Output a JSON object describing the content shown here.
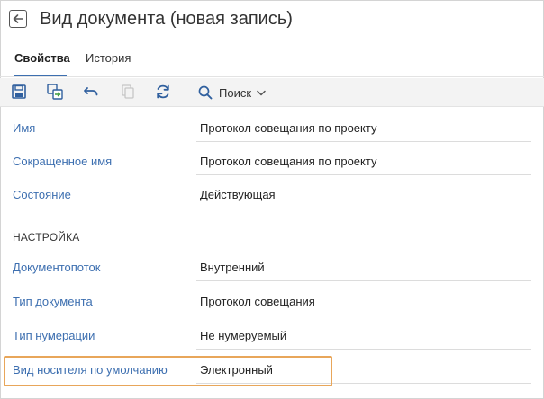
{
  "window": {
    "title": "Вид документа (новая запись)"
  },
  "tabs": [
    {
      "label": "Свойства",
      "active": true
    },
    {
      "label": "История",
      "active": false
    }
  ],
  "toolbar": {
    "icons": [
      "save-icon",
      "save-and-close-icon",
      "undo-icon",
      "copy-icon",
      "refresh-icon"
    ],
    "search_label": "Поиск"
  },
  "form": {
    "fields_main": [
      {
        "label": "Имя",
        "value": "Протокол совещания по проекту"
      },
      {
        "label": "Сокращенное имя",
        "value": "Протокол совещания по проекту"
      },
      {
        "label": "Состояние",
        "value": "Действующая"
      }
    ],
    "section_title": "НАСТРОЙКА",
    "fields_settings": [
      {
        "label": "Документопоток",
        "value": "Внутренний"
      },
      {
        "label": "Тип документа",
        "value": "Протокол совещания"
      },
      {
        "label": "Тип нумерации",
        "value": "Не нумеруемый"
      },
      {
        "label": "Вид носителя по умолчанию",
        "value": "Электронный"
      }
    ]
  },
  "colors": {
    "accent": "#3d6fb0",
    "highlight": "#e8a65a"
  }
}
